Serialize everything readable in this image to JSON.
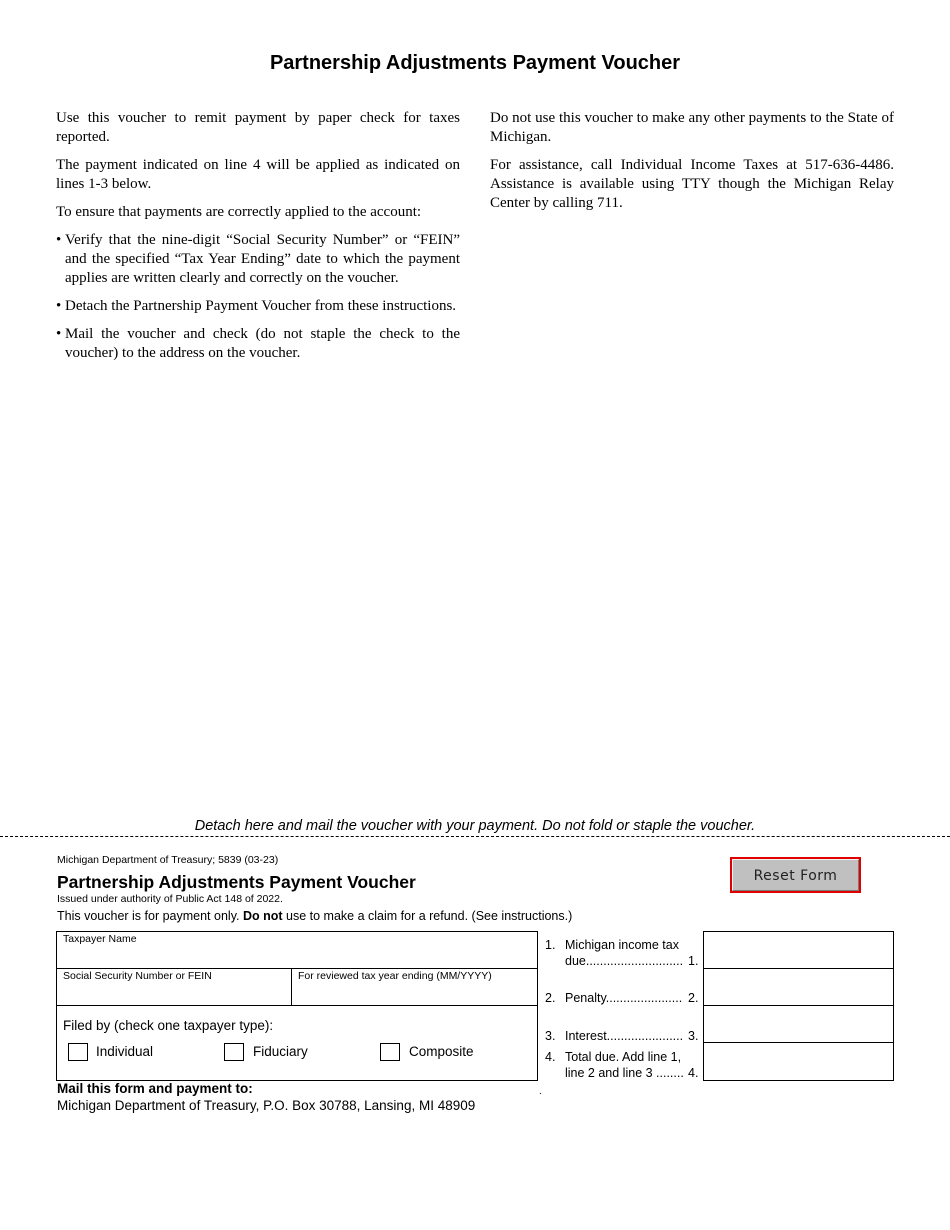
{
  "page_title": "Partnership Adjustments Payment Voucher",
  "instructions": {
    "left_paragraphs": [
      "Use this voucher to remit payment by paper check for taxes reported.",
      "The payment indicated on line 4 will be applied as indicated on lines 1-3 below.",
      "To ensure that payments are correctly applied to the account:"
    ],
    "bullets": [
      "Verify that the nine-digit “Social Security Number” or “FEIN” and the specified “Tax Year Ending” date to which the payment applies are written clearly and correctly on the voucher.",
      "Detach the Partnership Payment Voucher from these instructions.",
      "Mail the voucher and check (do not staple the check to the voucher) to the address on the voucher."
    ],
    "right_paragraphs": [
      "Do not use this voucher to make any other payments to the State of Michigan.",
      "For assistance, call Individual Income Taxes at 517-636-4486. Assistance is available using TTY though the Michigan Relay Center by calling 711."
    ]
  },
  "detach_notice": "Detach here and mail the voucher with your payment. Do not fold or staple the voucher.",
  "voucher": {
    "form_id": "Michigan Department of Treasury; 5839 (03-23)",
    "title": "Partnership Adjustments Payment Voucher",
    "authority": "Issued under authority of Public Act 148 of 2022.",
    "notice_prefix": "This voucher is for payment only.",
    "notice_bold": "Do not",
    "notice_suffix": "use to make a claim for a refund. (See instructions.)",
    "reset_button": "Reset Form",
    "fields": {
      "taxpayer_name": {
        "label": "Taxpayer Name",
        "value": ""
      },
      "ssn_fein": {
        "label": "Social Security Number or FEIN",
        "value": ""
      },
      "tax_year_ending": {
        "label": "For reviewed tax year ending (MM/YYYY)",
        "value": ""
      }
    },
    "filed_by": {
      "label": "Filed by (check one taxpayer type):",
      "options": [
        {
          "label": "Individual",
          "checked": false
        },
        {
          "label": "Fiduciary",
          "checked": false
        },
        {
          "label": "Composite",
          "checked": false
        }
      ]
    },
    "lines": [
      {
        "num": "1.",
        "text_1": "Michigan income tax",
        "text_2": "due............................",
        "ref": "1.",
        "value": ""
      },
      {
        "num": "2.",
        "text_1": "",
        "text_2": "Penalty......................",
        "ref": "2.",
        "value": ""
      },
      {
        "num": "3.",
        "text_1": "",
        "text_2": "Interest......................",
        "ref": "3.",
        "value": ""
      },
      {
        "num": "4.",
        "text_1": "Total due. Add line 1,",
        "text_2": "line 2 and line 3 ........",
        "ref": "4.",
        "value": ""
      }
    ],
    "mail_heading": "Mail this form and payment to:",
    "mail_address": "Michigan Department of Treasury, P.O. Box 30788, Lansing, MI 48909",
    "stray_mark": "."
  }
}
